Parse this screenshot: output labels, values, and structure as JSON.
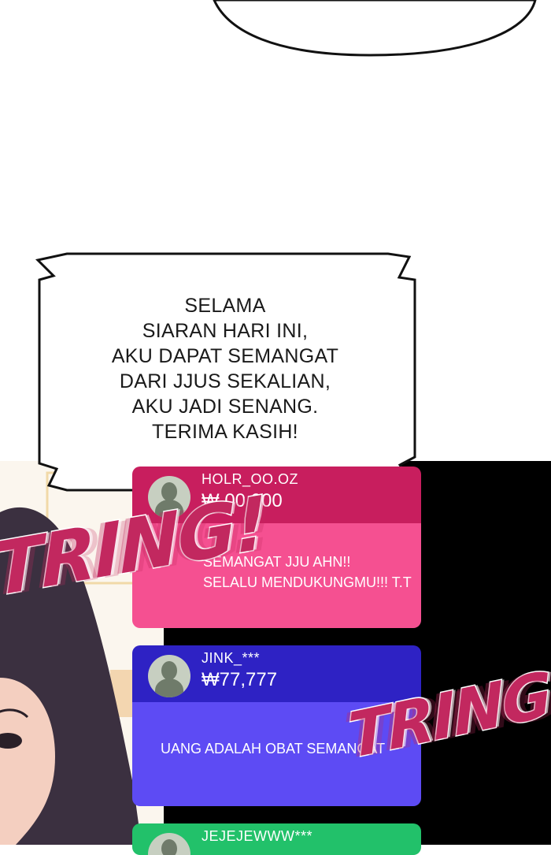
{
  "speech_bubble": {
    "lines": [
      "SELAMA",
      "SIARAN HARI INI,",
      "AKU DAPAT SEMANGAT",
      "DARI JJUS SEKALIAN,",
      "AKU JADI SENANG.",
      "TERIMA KASIH!"
    ]
  },
  "donations": [
    {
      "name": "HOLR_OO.OZ",
      "amount": "₩ 00,000",
      "message_lines": [
        "SEMANGAT JJU AHN!!",
        "SELALU MENDUKUNGMU!!! T.T"
      ],
      "head_color": "#c81e5e",
      "body_color": "#f55091"
    },
    {
      "name": "JINK_***",
      "amount": "₩77,777",
      "message_lines": [
        "UANG ADALAH OBAT SEMANGAT"
      ],
      "head_color": "#2e22c4",
      "body_color": "#5d4bf4"
    },
    {
      "name": "JEJEJEWWW***",
      "amount": "",
      "message_lines": [],
      "head_color": "#22c16a",
      "body_color": "#22c16a"
    }
  ],
  "sound_effects": [
    "TRING!",
    "TRING!"
  ],
  "colors": {
    "panel_black": "#000000",
    "bubble_fill": "#ffffff",
    "hair": "#3b3040",
    "skin": "#f4cfc0"
  }
}
